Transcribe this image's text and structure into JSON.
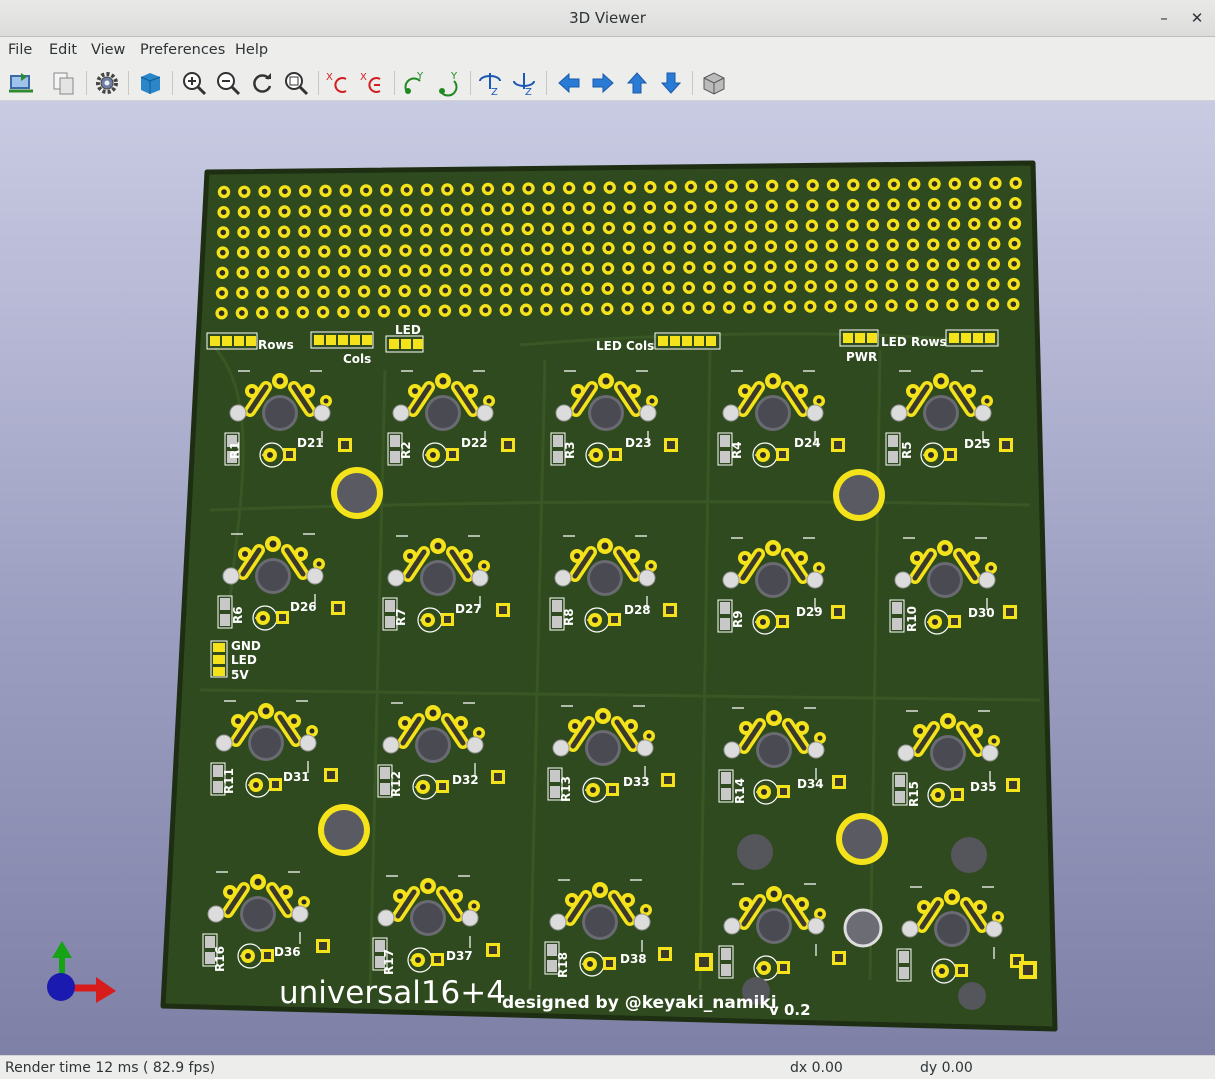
{
  "window": {
    "title": "3D Viewer",
    "minimize": "–",
    "close": "✕"
  },
  "menu": {
    "file": "File",
    "edit": "Edit",
    "view": "View",
    "preferences": "Preferences",
    "help": "Help"
  },
  "toolbar": {
    "icons": [
      "reload-board-icon",
      "copy-image-icon",
      "settings-icon",
      "raytracing-icon",
      "zoom-in-icon",
      "zoom-out-icon",
      "redraw-icon",
      "zoom-fit-icon",
      "rotate-x-cw-icon",
      "rotate-x-ccw-icon",
      "rotate-y-cw-icon",
      "rotate-y-ccw-icon",
      "rotate-z-cw-icon",
      "rotate-z-ccw-icon",
      "move-left-icon",
      "move-right-icon",
      "move-up-icon",
      "move-down-icon",
      "ortho-view-icon"
    ]
  },
  "board": {
    "headers": {
      "rows": "Rows",
      "cols": "Cols",
      "led": "LED",
      "led_cols": "LED Cols",
      "pwr": "PWR",
      "led_rows": "LED Rows"
    },
    "power_labels": {
      "gnd": "GND",
      "led": "LED",
      "v5": "5V"
    },
    "resistors": [
      "R1",
      "R2",
      "R3",
      "R4",
      "R5",
      "R6",
      "R7",
      "R8",
      "R9",
      "R10",
      "R11",
      "R12",
      "R13",
      "R14",
      "R15",
      "R16",
      "R17",
      "R18"
    ],
    "diodes": [
      "D21",
      "D22",
      "D23",
      "D24",
      "D25",
      "D26",
      "D27",
      "D28",
      "D29",
      "D30",
      "D31",
      "D32",
      "D33",
      "D34",
      "D35",
      "D36",
      "D37",
      "D38"
    ],
    "name": "universal16+4",
    "credit": "designed by @keyaki_namiki",
    "version": "v 0.2"
  },
  "colors": {
    "pcb": "#2f4a1e",
    "pad": "#f4e21a",
    "trace": "#3e5c28"
  },
  "status": {
    "render": "Render time 12 ms ( 82.9 fps)",
    "dx": "dx 0.00",
    "dy": "dy 0.00"
  }
}
